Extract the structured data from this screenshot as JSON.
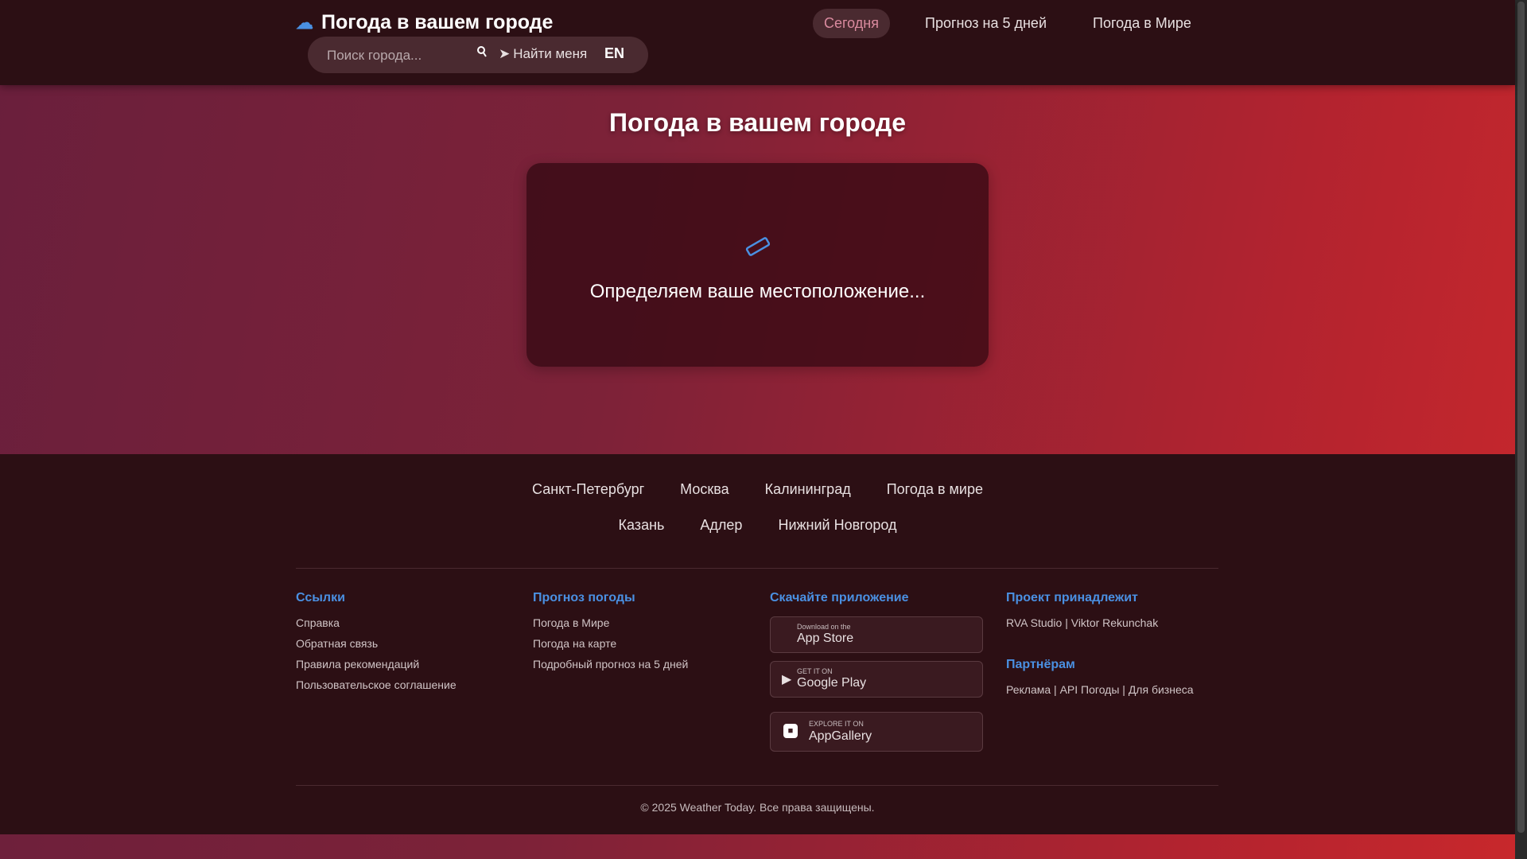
{
  "header": {
    "brand_title": "Погода в вашем городе",
    "search": {
      "placeholder": "Поиск города...",
      "value": ""
    },
    "find_me_label": "Найти меня",
    "lang_label": "EN",
    "tabs": [
      {
        "label": "Сегодня",
        "active": true
      },
      {
        "label": "Прогноз на 5 дней",
        "active": false
      },
      {
        "label": "Погода в Мире",
        "active": false
      }
    ]
  },
  "main": {
    "title": "Погода в вашем городе",
    "loading_message": "Определяем ваше местоположение..."
  },
  "footer": {
    "cities_row1": [
      "Санкт-Петербург",
      "Москва",
      "Калининград",
      "Погода в мире"
    ],
    "cities_row2": [
      "Казань",
      "Адлер",
      "Нижний Новгород"
    ],
    "links": {
      "heading": "Ссылки",
      "items": [
        "Справка",
        "Обратная связь",
        "Правила рекомендаций",
        "Пользовательское соглашение"
      ]
    },
    "forecast": {
      "heading": "Прогноз погоды",
      "items": [
        "Погода в Мире",
        "Погода на карте",
        "Подробный прогноз на 5 дней"
      ]
    },
    "apps": {
      "heading": "Скачайте приложение",
      "app_store": {
        "small": "Download on the",
        "big": "App Store"
      },
      "google_play": {
        "small": "GET IT ON",
        "big": "Google Play"
      },
      "app_gallery": {
        "small": "EXPLORE IT ON",
        "big": "AppGallery"
      }
    },
    "owner": {
      "heading": "Проект принадлежит",
      "items": [
        "RVA Studio",
        "Viktor Rekunchak"
      ]
    },
    "partners": {
      "heading": "Партнёрам",
      "items": [
        "Реклама",
        "API Погоды",
        "Для бизнеса"
      ]
    },
    "copyright": "© 2025 Weather Today. Все права защищены."
  },
  "colors": {
    "accent": "#4a90e2",
    "header_bg": "#2c0f14",
    "active_tab_text": "#d98a9e"
  },
  "icons": {
    "brand": "cloud-icon",
    "search": "search-icon",
    "find_me": "location-icon",
    "spinner": "spinner-icon"
  }
}
